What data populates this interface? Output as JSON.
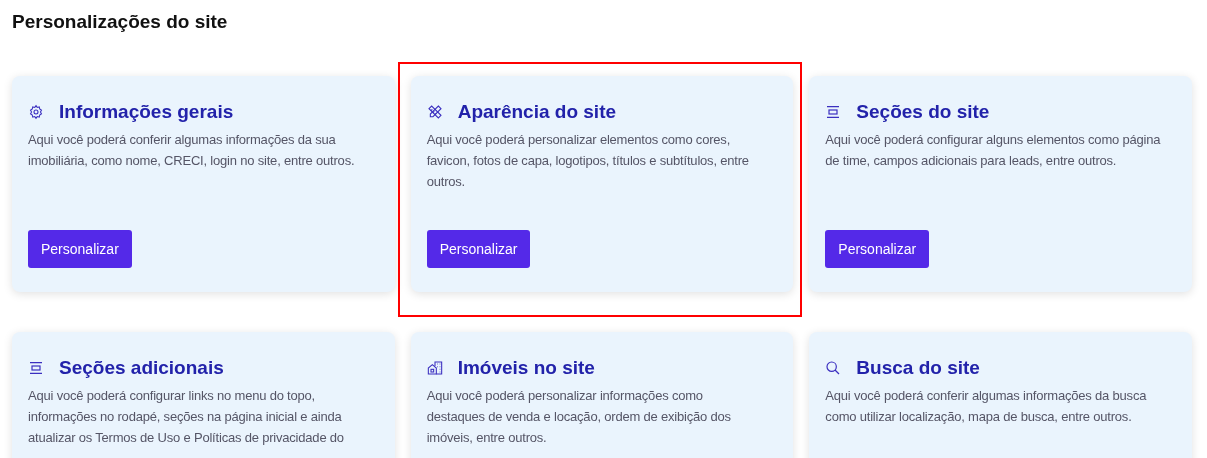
{
  "page_title": "Personalizações do site",
  "cards": [
    {
      "kind": "gear",
      "title": "Informações gerais",
      "description": "Aqui você poderá conferir algumas informações da sua imobiliária, como nome, CRECI, login no site, entre outros.",
      "button": "Personalizar",
      "highlighted": false
    },
    {
      "kind": "pencil-ruler",
      "title": "Aparência do site",
      "description": "Aqui você poderá personalizar elementos como cores, favicon, fotos de capa, logotipos, títulos e subtítulos, entre outros.",
      "button": "Personalizar",
      "highlighted": true
    },
    {
      "kind": "section",
      "title": "Seções do site",
      "description": "Aqui você poderá configurar alguns elementos como página de time, campos adicionais para leads, entre outros.",
      "button": "Personalizar",
      "highlighted": false
    },
    {
      "kind": "section",
      "title": "Seções adicionais",
      "description": "Aqui você poderá configurar links no menu do topo, informações no rodapé, seções na página inicial e ainda atualizar os Termos de Uso e Políticas de privacidade do",
      "highlighted": false
    },
    {
      "kind": "buildings",
      "title": "Imóveis no site",
      "description": "Aqui você poderá personalizar informações como destaques de venda e locação, ordem de exibição dos imóveis, entre outros.",
      "highlighted": false
    },
    {
      "kind": "search",
      "title": "Busca do site",
      "description": "Aqui você poderá conferir algumas informações da busca como utilizar localização, mapa de busca, entre outros.",
      "highlighted": false
    }
  ]
}
